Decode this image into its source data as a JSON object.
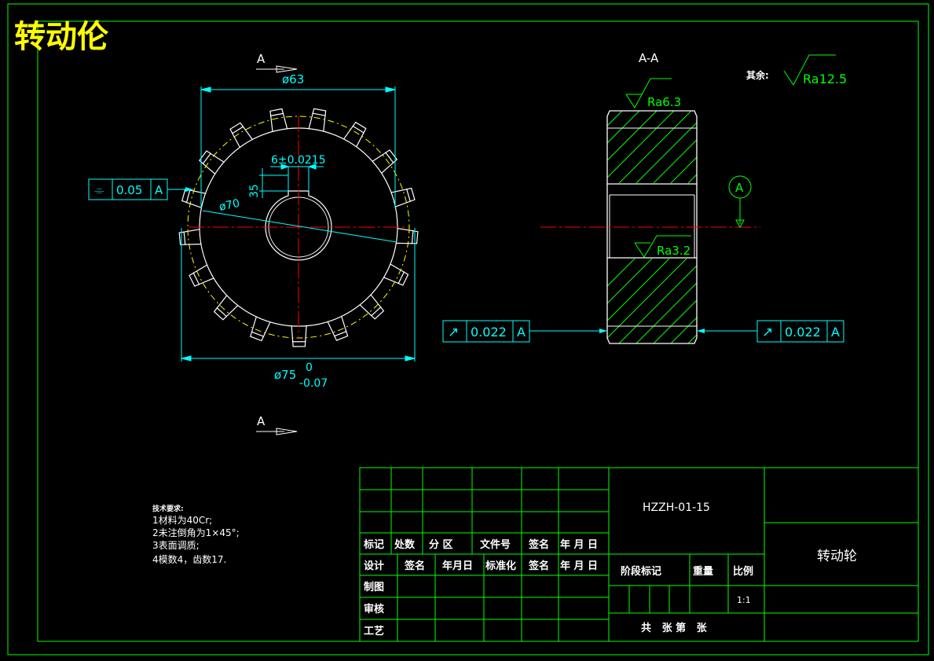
{
  "title": "转动伦",
  "section_label": "A",
  "section_view_label": "A-A",
  "dims": {
    "d63": "ø63",
    "d70": "ø70",
    "d75": "ø75",
    "d75_upper": "0",
    "d75_lower": "-0.07",
    "key_width": "6±0.0215",
    "key_depth": "35"
  },
  "roughness": {
    "other_label": "其余:",
    "other_value": "Ra12.5",
    "top": "Ra6.3",
    "bore": "Ra3.2"
  },
  "datum": "A",
  "tolerances": {
    "symmetry": {
      "symbol": "⌯",
      "value": "0.05",
      "datum": "A"
    },
    "runout_left": {
      "symbol": "↗",
      "value": "0.022",
      "datum": "A"
    },
    "runout_right": {
      "symbol": "↗",
      "value": "0.022",
      "datum": "A"
    }
  },
  "tech_requirements": {
    "heading": "技术要求:",
    "items": [
      "1材料为40Cr;",
      "2未注倒角为1×45°;",
      "3表面调质;",
      "4模数4，齿数17."
    ]
  },
  "title_block": {
    "drawing_no": "HZZH-01-15",
    "part_name": "转动轮",
    "row_revision": [
      "标记",
      "处数",
      "分 区",
      "文件号",
      "签名",
      "年 月 日"
    ],
    "row_design": [
      "设计",
      "签名",
      "年月日",
      "标准化",
      "签名",
      "年 月 日"
    ],
    "row_labels": [
      "制图",
      "审核",
      "工艺"
    ],
    "stage_mark": "阶段标记",
    "weight": "重量",
    "scale": "比例",
    "scale_value": "1:1",
    "sheets": "共   张 第   张"
  },
  "colors": {
    "frame": "#00ff00",
    "outline": "#ffffff",
    "dimension": "#00ffff",
    "center": "#ff0000",
    "hatch": "#00ff00",
    "pitch": "#ffff00",
    "title": "#ffff00",
    "text": "#ffffff"
  }
}
